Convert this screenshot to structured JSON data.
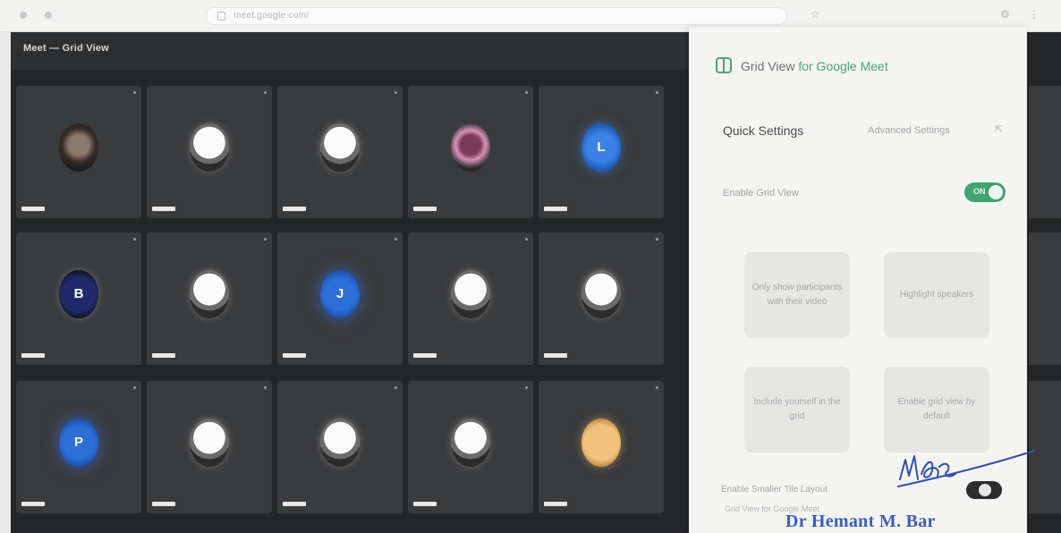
{
  "browser": {
    "url": "meet.google.com/"
  },
  "meeting": {
    "title": "Meet — Grid View",
    "tiles": [
      {
        "row": 0,
        "col": 0,
        "avatar": "dark"
      },
      {
        "row": 0,
        "col": 1,
        "avatar": "photo"
      },
      {
        "row": 0,
        "col": 2,
        "avatar": "photo"
      },
      {
        "row": 0,
        "col": 3,
        "avatar": "pink"
      },
      {
        "row": 0,
        "col": 4,
        "avatar": "blue",
        "letter": "L"
      },
      {
        "row": 1,
        "col": 0,
        "avatar": "navy",
        "letter": "B"
      },
      {
        "row": 1,
        "col": 1,
        "avatar": "photo"
      },
      {
        "row": 1,
        "col": 2,
        "avatar": "blue2",
        "letter": "J"
      },
      {
        "row": 1,
        "col": 3,
        "avatar": "photo"
      },
      {
        "row": 1,
        "col": 4,
        "avatar": "photo"
      },
      {
        "row": 2,
        "col": 0,
        "avatar": "blue2",
        "letter": "P"
      },
      {
        "row": 2,
        "col": 1,
        "avatar": "photo"
      },
      {
        "row": 2,
        "col": 2,
        "avatar": "photo"
      },
      {
        "row": 2,
        "col": 3,
        "avatar": "photo"
      },
      {
        "row": 2,
        "col": 4,
        "avatar": "gold"
      }
    ]
  },
  "panel": {
    "title_prefix": "Grid View",
    "title_suffix": "for Google Meet",
    "quick_settings": "Quick Settings",
    "advanced_settings": "Advanced Settings",
    "enable_label": "Enable Grid View",
    "toggle_on": "ON",
    "cards": [
      "Only show participants with their video",
      "Highlight speakers",
      "Include yourself in the grid",
      "Enable grid view by default"
    ],
    "layout_label": "Enable Smaller Tile Layout",
    "footer_text": "Grid View for Google Meet"
  },
  "annotation": {
    "signature": "HMBz",
    "stamp_name": "Dr Hemant M. Bar"
  },
  "colors": {
    "accent": "#4aa37b",
    "toggle_on": "#3fa46e",
    "stamp": "#3a5fc0",
    "meet_background": "#242526"
  }
}
